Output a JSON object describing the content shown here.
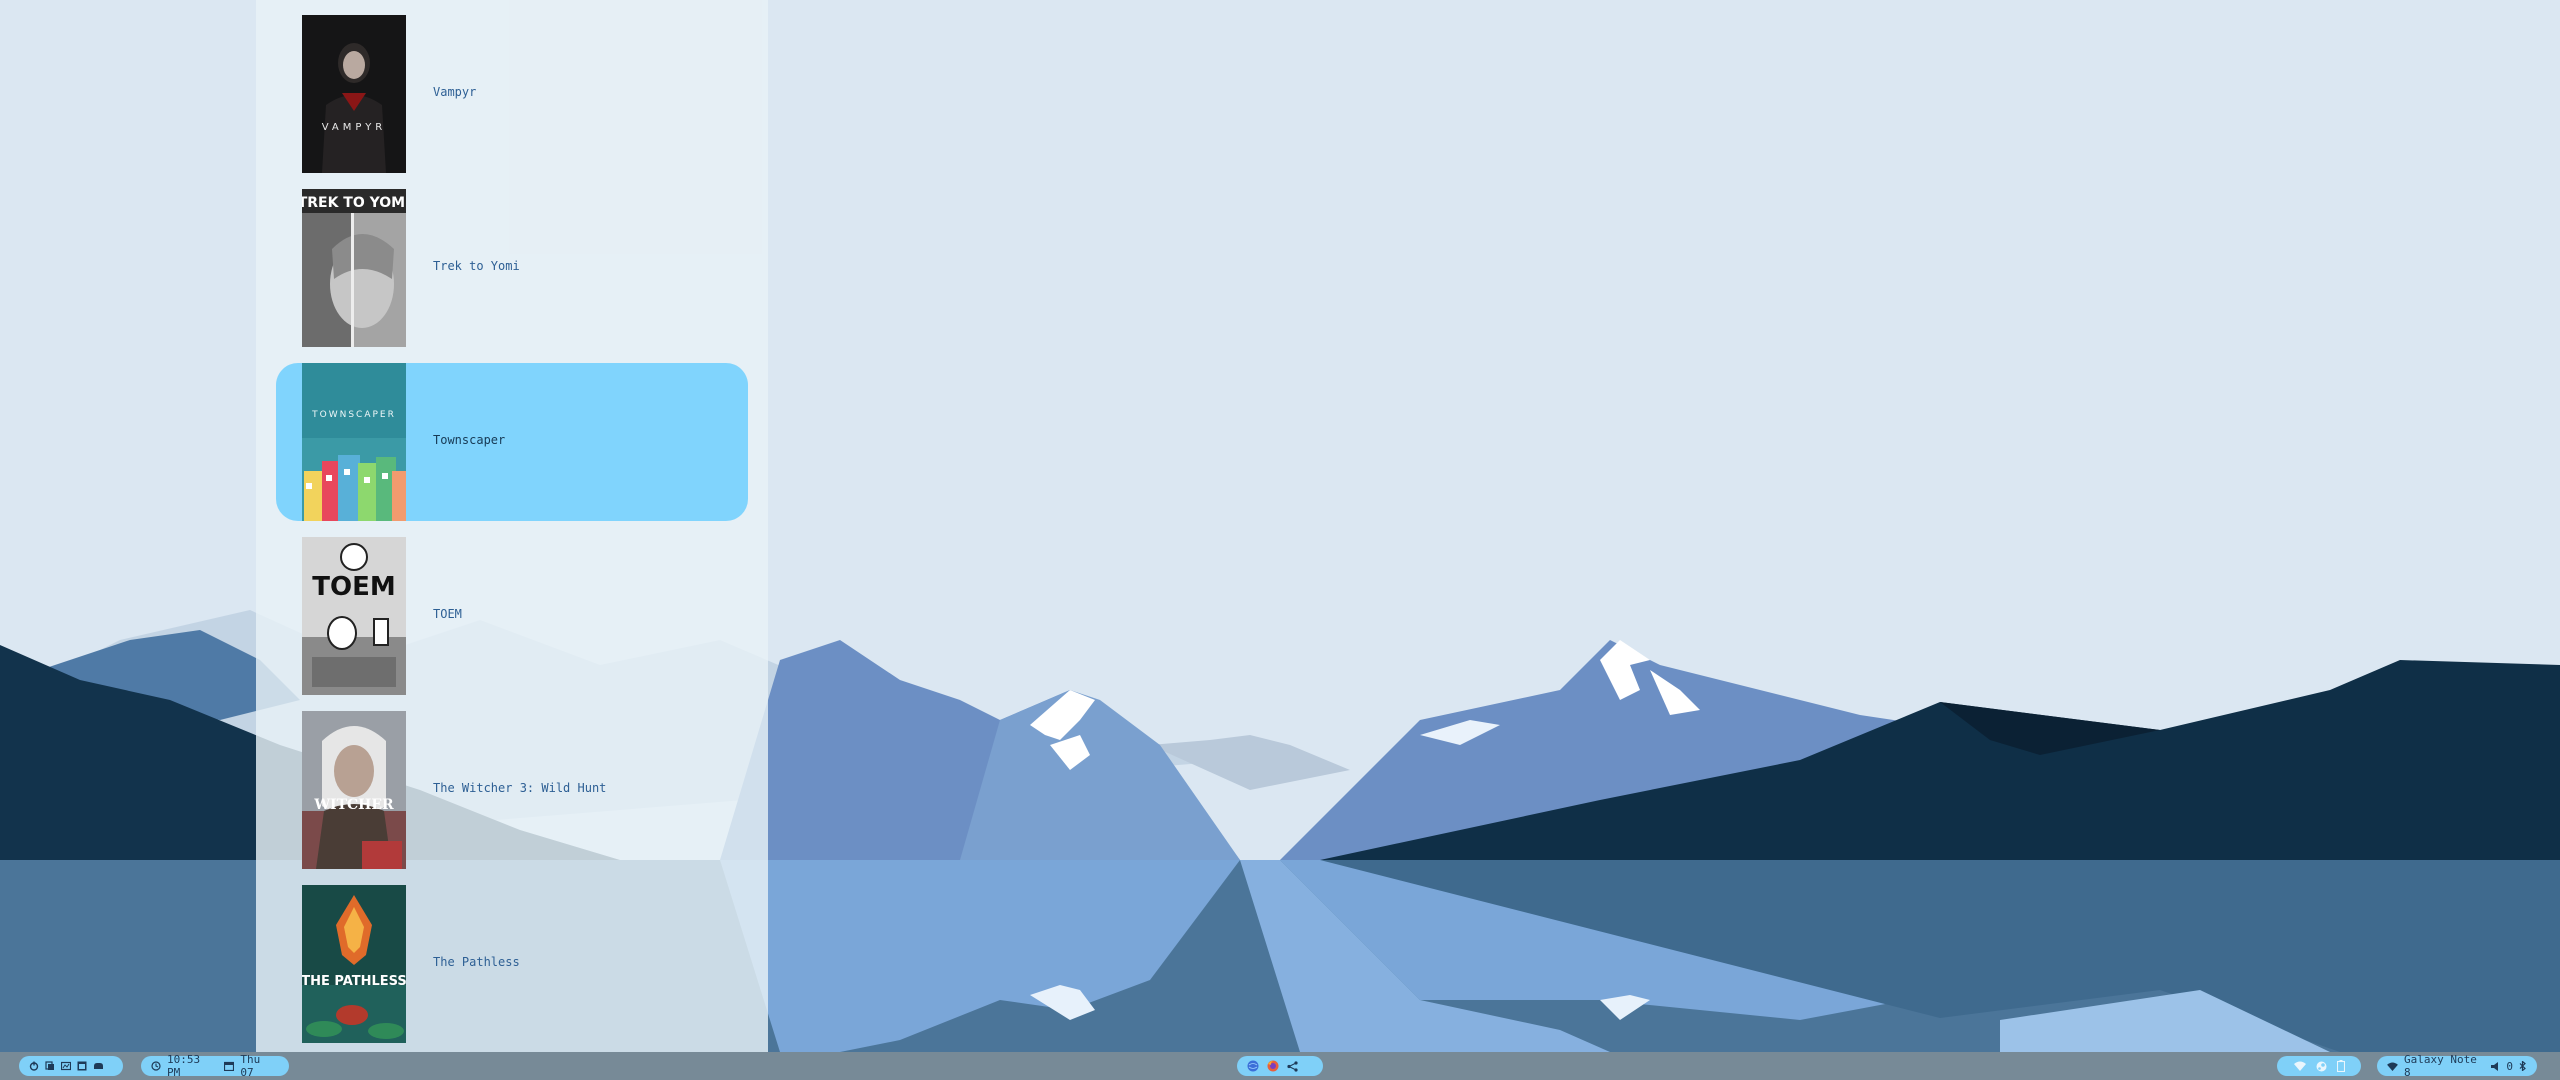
{
  "launcher": {
    "games": [
      {
        "title": "Vampyr",
        "cover_text": "VAMPYR"
      },
      {
        "title": "Trek to Yomi",
        "cover_text": "TREK TO YOMI"
      },
      {
        "title": "Townscaper",
        "cover_text": "TOWNSCAPER",
        "selected": true
      },
      {
        "title": "TOEM",
        "cover_text": "TOEM"
      },
      {
        "title": "The Witcher 3: Wild Hunt",
        "cover_text": "WITCHER"
      },
      {
        "title": "The Pathless",
        "cover_text": "THE PATHLESS"
      }
    ]
  },
  "taskbar": {
    "clock": "10:53 PM",
    "date": "Thu 07",
    "device_name": "Galaxy Note 8",
    "volume": "0",
    "workspace_icons": [
      "power-icon",
      "copy-icon",
      "screenshot-icon",
      "window-icon",
      "cloud-icon"
    ],
    "tray_apps": [
      "globe-icon",
      "firefox-icon",
      "share-icon"
    ],
    "status_icons": [
      "wifi-icon",
      "steam-icon",
      "battery-icon"
    ]
  },
  "colors": {
    "selection": "#80d4fd",
    "pill": "#7fd0f8",
    "taskbar": "#6c7f8d",
    "sky": "#dbe7f2"
  }
}
